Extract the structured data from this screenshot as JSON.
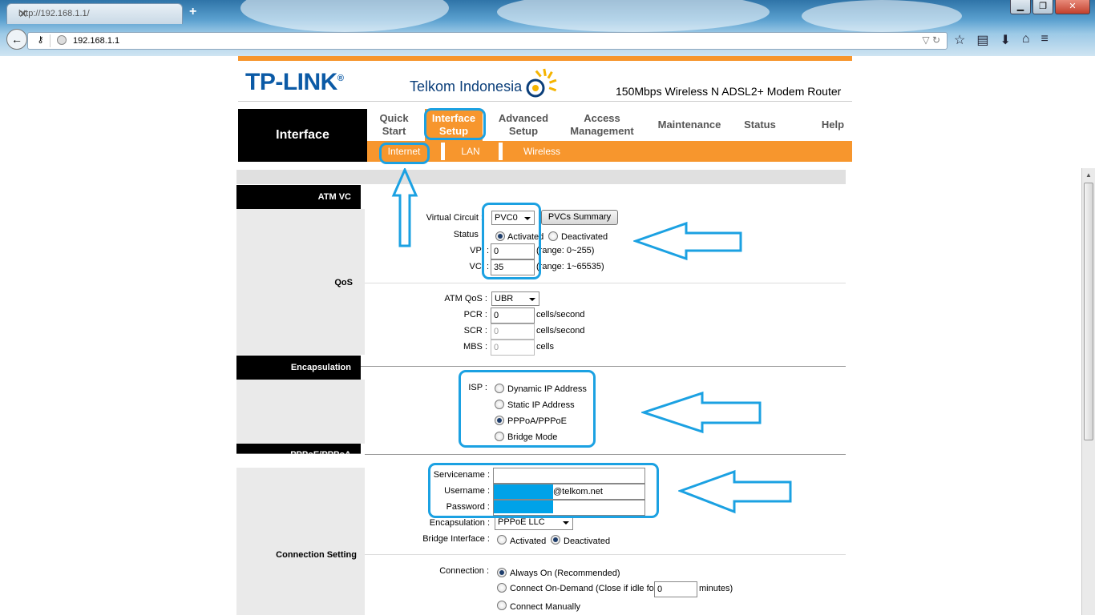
{
  "browser": {
    "tab_title": "http://192.168.1.1/",
    "new_tab": "+",
    "url": "192.168.1.1",
    "win_minimize": "▁",
    "win_restore": "❐",
    "win_close": "✕"
  },
  "header": {
    "brand": "TP-LINK",
    "brand_mark": "®",
    "partner": "Telkom Indonesia",
    "model": "150Mbps Wireless N ADSL2+ Modem Router"
  },
  "nav": {
    "section_label": "Interface",
    "items": [
      {
        "label": "Quick\nStart"
      },
      {
        "label": "Interface\nSetup"
      },
      {
        "label": "Advanced\nSetup"
      },
      {
        "label": "Access\nManagement"
      },
      {
        "label": "Maintenance"
      },
      {
        "label": "Status"
      },
      {
        "label": "Help"
      }
    ],
    "active_index": 1,
    "sub_items": [
      {
        "label": "Internet"
      },
      {
        "label": "LAN"
      },
      {
        "label": "Wireless"
      }
    ]
  },
  "sections": {
    "atm_vc": "ATM VC",
    "qos": "QoS",
    "encapsulation": "Encapsulation",
    "pppoe": "PPPoE/PPPoA",
    "connection_setting": "Connection Setting"
  },
  "atm": {
    "virtual_circuit_label": "Virtual Circuit :",
    "virtual_circuit_value": "PVC0",
    "pvcs_summary_button": "PVCs Summary",
    "status_label": "Status :",
    "status_activated": "Activated",
    "status_deactivated": "Deactivated",
    "vpi_label": "VPI :",
    "vpi_value": "0",
    "vpi_range": "(range: 0~255)",
    "vci_label": "VCI :",
    "vci_value": "35",
    "vci_range": "(range: 1~65535)"
  },
  "qos": {
    "atm_qos_label": "ATM QoS :",
    "atm_qos_value": "UBR",
    "pcr_label": "PCR :",
    "pcr_value": "0",
    "scr_label": "SCR :",
    "scr_value": "0",
    "mbs_label": "MBS :",
    "mbs_value": "0",
    "cells_per_second": "cells/second",
    "cells": "cells"
  },
  "isp": {
    "label": "ISP :",
    "options": [
      "Dynamic IP Address",
      "Static IP Address",
      "PPPoA/PPPoE",
      "Bridge Mode"
    ],
    "selected_index": 2
  },
  "pppoe": {
    "servicename_label": "Servicename :",
    "servicename_value": "",
    "username_label": "Username :",
    "username_suffix": "@telkom.net",
    "password_label": "Password :",
    "encapsulation_label": "Encapsulation :",
    "encapsulation_value": "PPPoE LLC",
    "bridge_label": "Bridge Interface :",
    "bridge_activated": "Activated",
    "bridge_deactivated": "Deactivated"
  },
  "connection": {
    "label": "Connection :",
    "always_on": "Always On (Recommended)",
    "on_demand": "Connect On-Demand (Close if idle for",
    "idle_value": "0",
    "minutes": "minutes)",
    "manually": "Connect Manually"
  },
  "colors": {
    "orange": "#f7962d",
    "annotation_blue": "#1ba1e2",
    "redact_blue": "#00a2e8"
  }
}
